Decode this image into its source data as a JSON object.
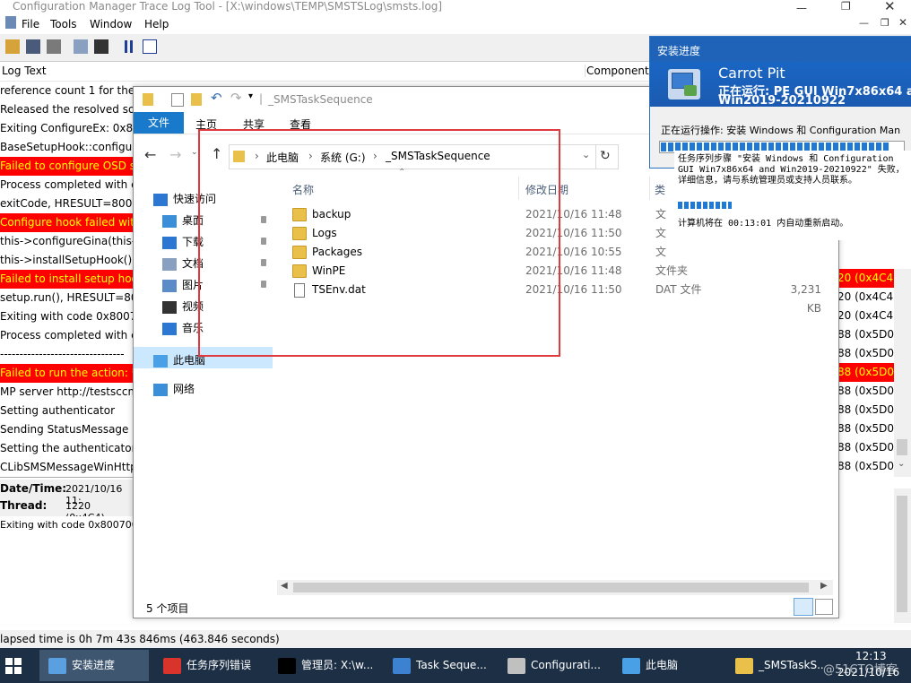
{
  "cmtrace": {
    "title": "Configuration Manager Trace Log Tool - [X:\\windows\\TEMP\\SMSTSLog\\smsts.log]",
    "menu": [
      "File",
      "Tools",
      "Window",
      "Help"
    ],
    "header": {
      "log_text": "Log Text",
      "component": "Component"
    },
    "rows": [
      {
        "text": "reference count 1 for the s",
        "error": false
      },
      {
        "text": "Released the resolved sou",
        "error": false
      },
      {
        "text": "Exiting ConfigureEx: 0x800",
        "error": false
      },
      {
        "text": "BaseSetupHook::configure",
        "error": false
      },
      {
        "text": "Failed to configure OSD se",
        "error": true
      },
      {
        "text": "Process completed with ex",
        "error": false
      },
      {
        "text": "exitCode, HRESULT=80070",
        "error": false
      },
      {
        "text": "Configure hook failed with",
        "error": true
      },
      {
        "text": "this->configureGina(this->",
        "error": false
      },
      {
        "text": "this->installSetupHook(), H",
        "error": false
      },
      {
        "text": "Failed to install setup hook",
        "error": true
      },
      {
        "text": "setup.run(), HRESULT=800",
        "error": false
      },
      {
        "text": "Exiting with code 0x80070",
        "error": false
      },
      {
        "text": "Process completed with ex",
        "error": false
      },
      {
        "text": "--------------------------------",
        "error": false
      },
      {
        "text": "Failed to run the action: 安",
        "error": true
      },
      {
        "text": "MP server http://testsccm.",
        "error": false
      },
      {
        "text": "Setting authenticator",
        "error": false
      },
      {
        "text": "Sending StatusMessage",
        "error": false
      },
      {
        "text": "Setting the authenticator.",
        "error": false
      },
      {
        "text": "CLibSMSMessageWinHttpT",
        "error": false
      }
    ],
    "right_rows": [
      {
        "text": "20 (0x4C4)",
        "error": true
      },
      {
        "text": "20 (0x4C4)",
        "error": false
      },
      {
        "text": "20 (0x4C4)",
        "error": false
      },
      {
        "text": "88 (0x5D0)",
        "error": false
      },
      {
        "text": "88 (0x5D0)",
        "error": false
      },
      {
        "text": "88 (0x5D0)",
        "error": true
      },
      {
        "text": "88 (0x5D0)",
        "error": false
      },
      {
        "text": "88 (0x5D0)",
        "error": false
      },
      {
        "text": "88 (0x5D0)",
        "error": false
      },
      {
        "text": "88 (0x5D0)",
        "error": false
      },
      {
        "text": "88 (0x5D0)",
        "error": false
      }
    ],
    "detail": {
      "date_label": "Date/Time:",
      "date_value": "2021/10/16 11:",
      "thread_label": "Thread:",
      "thread_value": "1220 (0x4C4)",
      "message": "Exiting with code 0x800700B7"
    },
    "status": "lapsed time is 0h 7m 43s 846ms (463.846 seconds)"
  },
  "explorer": {
    "title": "_SMSTaskSequence",
    "ribbon": {
      "file": "文件",
      "tabs": [
        "主页",
        "共享",
        "查看"
      ]
    },
    "address": [
      "此电脑",
      "系统 (G:)",
      "_SMSTaskSequence"
    ],
    "nav": [
      {
        "label": "快速访问",
        "pinned": false
      },
      {
        "label": "桌面",
        "pinned": true
      },
      {
        "label": "下载",
        "pinned": true
      },
      {
        "label": "文档",
        "pinned": true
      },
      {
        "label": "图片",
        "pinned": true
      },
      {
        "label": "视频",
        "pinned": false
      },
      {
        "label": "音乐",
        "pinned": false
      },
      {
        "label": "此电脑",
        "pinned": false
      },
      {
        "label": "网络",
        "pinned": false
      }
    ],
    "columns": {
      "name": "名称",
      "modified": "修改日期",
      "type": "类"
    },
    "files": [
      {
        "name": "backup",
        "modified": "2021/10/16 11:48",
        "type": "文",
        "size": "",
        "kind": "folder"
      },
      {
        "name": "Logs",
        "modified": "2021/10/16 11:50",
        "type": "文",
        "size": "",
        "kind": "folder"
      },
      {
        "name": "Packages",
        "modified": "2021/10/16 10:55",
        "type": "文",
        "size": "",
        "kind": "folder"
      },
      {
        "name": "WinPE",
        "modified": "2021/10/16 11:48",
        "type": "文件夹",
        "size": "",
        "kind": "folder"
      },
      {
        "name": "TSEnv.dat",
        "modified": "2021/10/16 11:50",
        "type": "DAT 文件",
        "size": "3,231 KB",
        "kind": "file"
      }
    ],
    "status": "5 个项目",
    "highlight_color": "#e0393e"
  },
  "progress": {
    "title": "安装进度",
    "org": "Carrot Pit",
    "running_line1": "正在运行: PE GUI Win7x86x64 a",
    "running_line2": "Win2019-20210922",
    "operation": "正在运行操作: 安装 Windows 和 Configuration Man",
    "level": 0.94,
    "error_lines": [
      "任务序列步骤 \"安装 Windows 和 Configuration",
      "GUI Win7x86x64 and Win2019-20210922\" 失败，",
      "详细信息，请与系统管理员或支持人员联系。"
    ],
    "restart": "计算机将在 00:13:01 内自动重新启动。"
  },
  "taskbar": {
    "items": [
      {
        "label": "安装进度",
        "active": true,
        "color": "#5aa0e0"
      },
      {
        "label": "任务序列错误",
        "active": false,
        "color": "#d9342b"
      },
      {
        "label": "管理员: X:\\w...",
        "active": false,
        "color": "#000000"
      },
      {
        "label": "Task Seque...",
        "active": false,
        "color": "#3c82d0"
      },
      {
        "label": "Configurati...",
        "active": false,
        "color": "#c0c0c0"
      },
      {
        "label": "此电脑",
        "active": false,
        "color": "#4aa0e6"
      },
      {
        "label": "_SMSTaskS...",
        "active": false,
        "color": "#e8c04a"
      }
    ],
    "time": "12:13",
    "date": "2021/10/16",
    "watermark": "@51CTO博客"
  }
}
